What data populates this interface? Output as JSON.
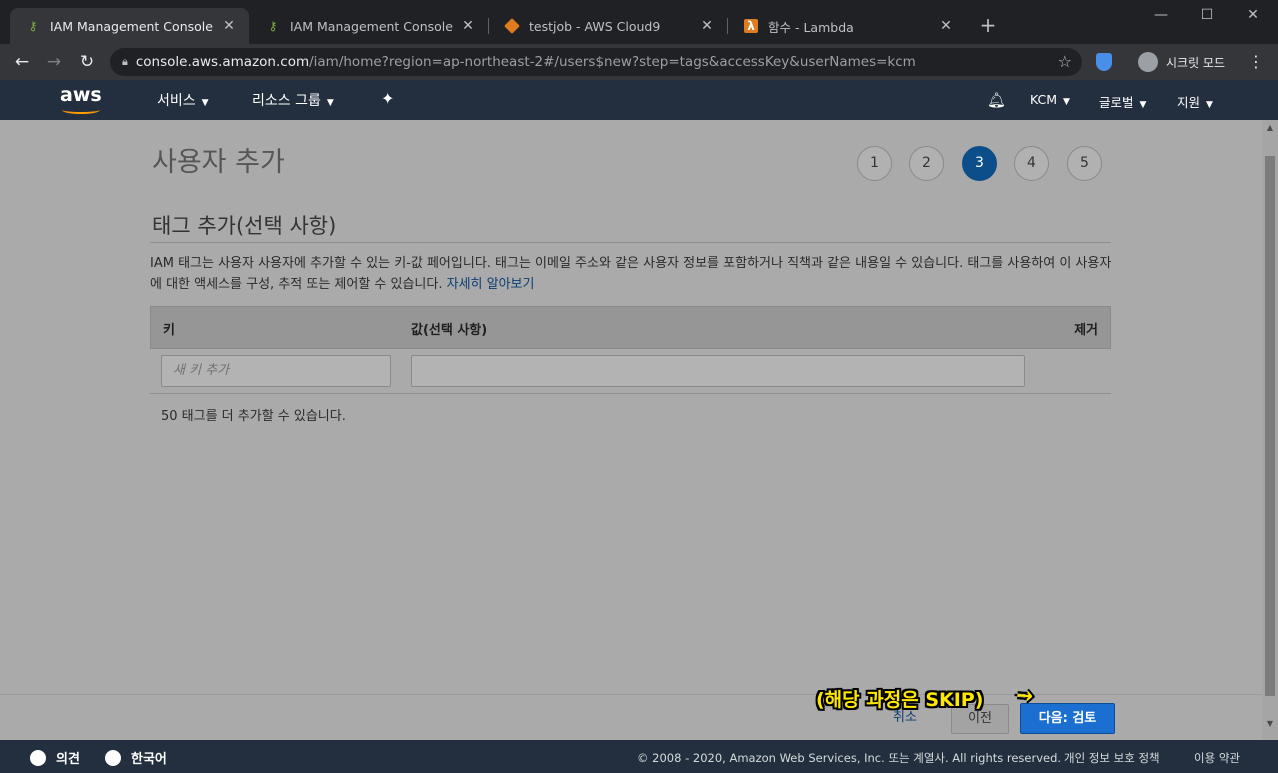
{
  "browser": {
    "tabs": [
      {
        "title": "IAM Management Console",
        "active": true,
        "icon": "key-icon"
      },
      {
        "title": "IAM Management Console",
        "active": false,
        "icon": "key-icon"
      },
      {
        "title": "testjob - AWS Cloud9",
        "active": false,
        "icon": "cloud9-icon"
      },
      {
        "title": "함수 - Lambda",
        "active": false,
        "icon": "lambda-icon"
      }
    ],
    "close_glyph": "✕",
    "newtab_glyph": "+",
    "window": {
      "minimize": "—",
      "maximize": "☐",
      "close": "✕"
    },
    "address": {
      "host": "console.aws.amazon.com",
      "path": "/iam/home?region=ap-northeast-2#/users$new?step=tags&accessKey&userNames=kcm"
    },
    "incognito_label": "시크릿 모드"
  },
  "aws_nav": {
    "logo": "aws",
    "services": "서비스",
    "resource_groups": "리소스 그룹",
    "account": "KCM",
    "region": "글로벌",
    "support": "지원"
  },
  "page": {
    "title": "사용자 추가",
    "steps": [
      "1",
      "2",
      "3",
      "4",
      "5"
    ],
    "active_step": 3,
    "section_title": "태그 추가(선택 사항)",
    "description": "IAM 태그는 사용자 사용자에 추가할 수 있는 키-값 페어입니다. 태그는 이메일 주소와 같은 사용자 정보를 포함하거나 직책과 같은 내용일 수 있습니다. 태그를 사용하여 이 사용자에 대한 액세스를 구성, 추적 또는 제어할 수 있습니다.",
    "learn_more": "자세히 알아보기",
    "table": {
      "col_key": "키",
      "col_value": "값(선택 사항)",
      "col_remove": "제거",
      "key_placeholder": "새 키 추가",
      "value": ""
    },
    "remaining_text": "50 태그를 더 추가할 수 있습니다.",
    "buttons": {
      "cancel": "취소",
      "previous": "이전",
      "next": "다음: 검토"
    },
    "annotation": "(해당 과정은 SKIP)"
  },
  "footer": {
    "feedback": "의견",
    "language": "한국어",
    "copyright": "© 2008 - 2020, Amazon Web Services, Inc. 또는 계열사. All rights reserved.",
    "privacy": "개인 정보 보호 정책",
    "terms": "이용 약관"
  },
  "colors": {
    "aws_nav": "#232f3e",
    "aws_orange": "#ff9900",
    "primary_button": "#1a6fd1",
    "active_step": "#0b4e8a",
    "annotation": "#ffe800"
  }
}
